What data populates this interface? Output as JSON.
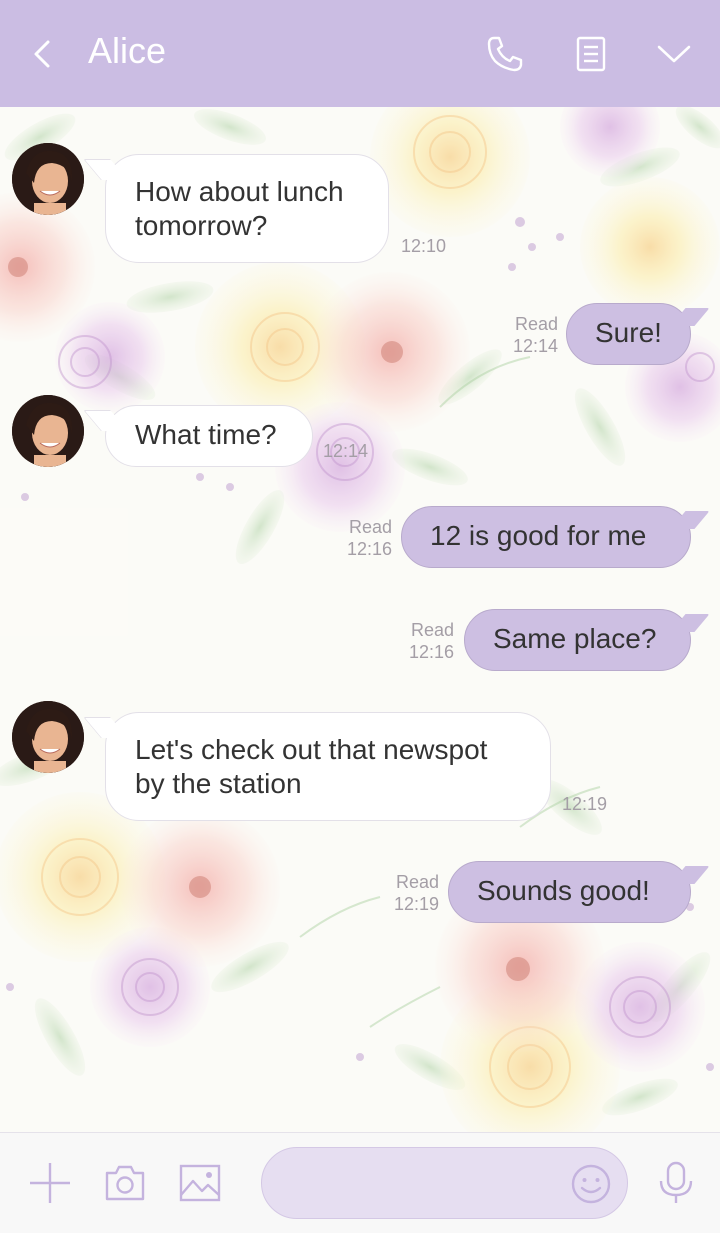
{
  "header": {
    "title": "Alice",
    "back_icon": "chevron-left-icon",
    "icons": [
      "phone-icon",
      "notes-icon",
      "chevron-down-icon"
    ],
    "background_color": "#cbbde3"
  },
  "messages": [
    {
      "direction": "in",
      "text_line1": "How about lunch",
      "text_line2": "tomorrow?",
      "time": "12:10"
    },
    {
      "direction": "out",
      "text": "Sure!",
      "status": "Read",
      "time": "12:14"
    },
    {
      "direction": "in",
      "text": "What time?",
      "time": "12:14"
    },
    {
      "direction": "out",
      "text": "12 is good for me",
      "status": "Read",
      "time": "12:16"
    },
    {
      "direction": "out",
      "text": "Same place?",
      "status": "Read",
      "time": "12:16"
    },
    {
      "direction": "in",
      "text_line1": "Let's check out that newspot",
      "text_line2": "by the station",
      "time": "12:19"
    },
    {
      "direction": "out",
      "text": "Sounds good!",
      "status": "Read",
      "time": "12:19"
    }
  ],
  "bottom_bar": {
    "icons": [
      "plus-icon",
      "camera-icon",
      "gallery-icon",
      "smile-icon",
      "microphone-icon"
    ],
    "input_placeholder": ""
  },
  "colors": {
    "accent": "#cbbde3",
    "outgoing_bubble": "#cdbfe2",
    "incoming_bubble": "#ffffff",
    "meta_text": "#a49ea6"
  }
}
